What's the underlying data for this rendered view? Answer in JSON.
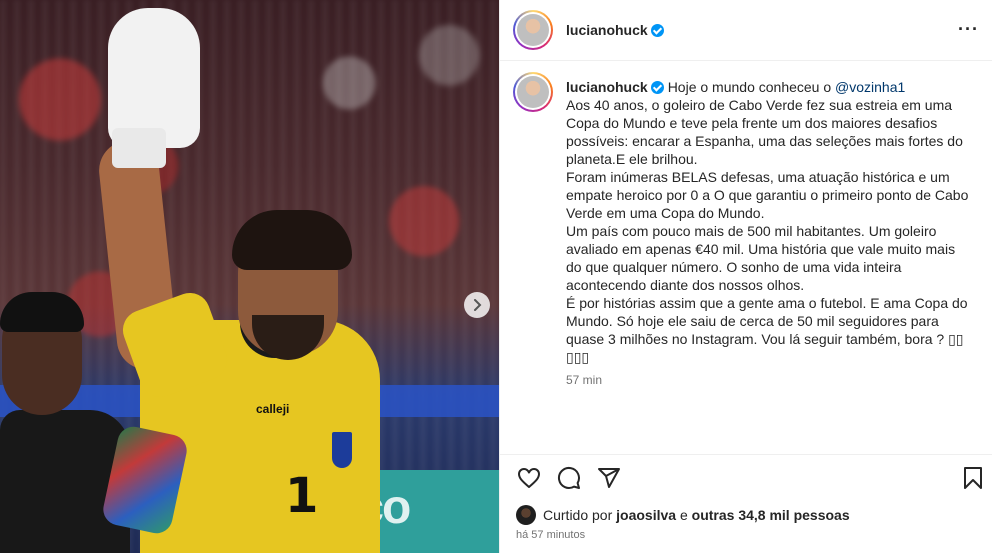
{
  "post": {
    "username": "lucianohuck",
    "caption_parts": {
      "intro": "Hoje o mundo conheceu o ",
      "mention": "@vozinha1",
      "emoji": " ",
      "body": "Aos 40 anos, o goleiro de Cabo Verde fez sua estreia em uma Copa do Mundo e teve pela frente um dos maiores desafios possíveis: encarar a Espanha, uma das seleções mais fortes do planeta.E ele brilhou.\nForam inúmeras BELAS defesas, uma atuação histórica e um empate heroico por 0 a O que garantiu o primeiro ponto de Cabo Verde em uma Copa do Mundo.\nUm país com pouco mais de 500 mil habitantes. Um goleiro avaliado em apenas €40 mil. Uma história que vale muito mais do que qualquer número. O sonho de uma vida inteira acontecendo diante dos nossos olhos.\nÉ por histórias assim que a gente ama o futebol. E ama Copa do Mundo. Só hoje ele saiu de cerca de 50 mil seguidores para quase 3 milhões no Instagram. Vou lá seguir também, bora ? ▯▯\n▯▯▯"
    },
    "caption_time": "57 min",
    "likes": {
      "prefix": "Curtido por ",
      "user": "joaosilva",
      "middle": " e ",
      "others": "outras 34,8 mil pessoas"
    },
    "post_time": "há 57 minutos"
  },
  "photo": {
    "jersey_number": "1",
    "jersey_brand": "calleji",
    "banner_text": "nco"
  },
  "icons": {
    "verified": "verified-badge-icon",
    "more": "more-options-icon",
    "like": "heart-icon",
    "comment": "comment-icon",
    "share": "share-icon",
    "save": "bookmark-icon",
    "next": "chevron-right-icon"
  },
  "colors": {
    "verified": "#0095f6",
    "text": "#262626",
    "muted": "#737373",
    "mention": "#00376b"
  }
}
